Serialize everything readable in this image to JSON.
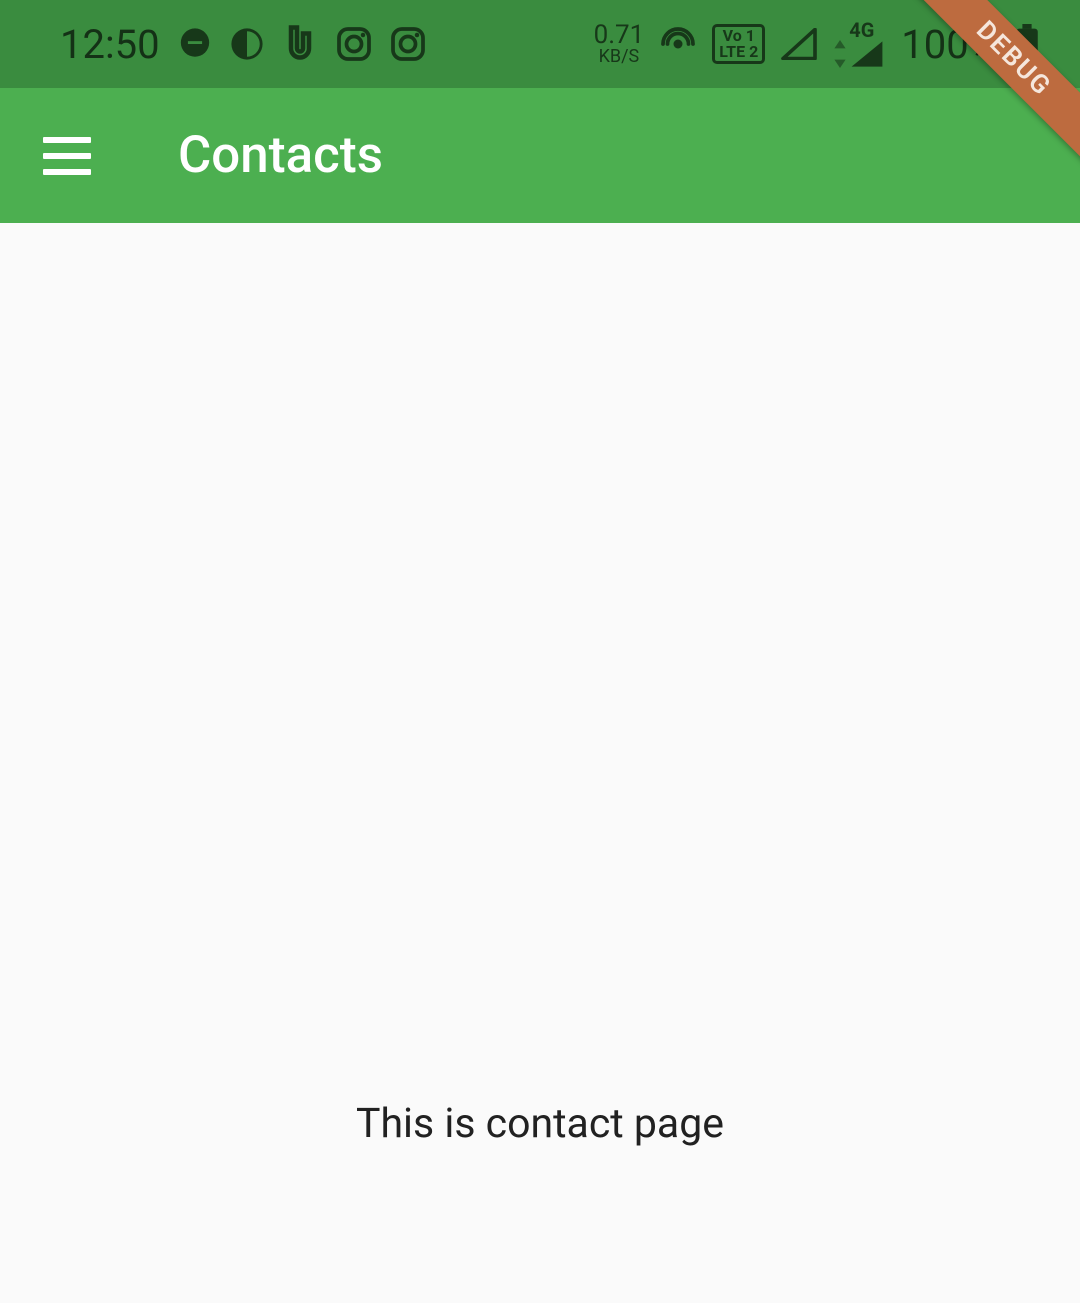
{
  "status_bar": {
    "time": "12:50",
    "net_speed_value": "0.71",
    "net_speed_unit": "KB/S",
    "lte_label_top": "Vo 1",
    "lte_label_bottom": "LTE 2",
    "fourg_label": "4G",
    "battery_pct": "100%"
  },
  "app_bar": {
    "title": "Contacts"
  },
  "content": {
    "text": "This is contact page"
  },
  "banner": {
    "label": "DEBUG"
  }
}
